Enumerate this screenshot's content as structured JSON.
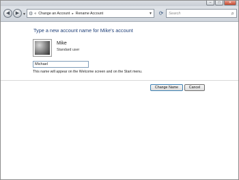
{
  "window_controls": {
    "minimize": "–",
    "maximize": "□",
    "close": "✕"
  },
  "nav": {
    "back_glyph": "◀",
    "forward_glyph": "▶",
    "breadcrumbs": [
      "Change an Account",
      "Rename Account"
    ],
    "breadcrumb_separator": "▸",
    "overflow_marker": "«",
    "search_placeholder": "Search"
  },
  "main": {
    "heading": "Type a new account name for Mike's account",
    "user": {
      "name": "Mike",
      "type": "Standard user"
    },
    "new_name_value": "Michael",
    "hint": "This name will appear on the Welcome screen and on the Start menu.",
    "buttons": {
      "change": "Change Name",
      "cancel": "Cancel"
    }
  },
  "colors": {
    "heading": "#1f3f77",
    "accent_button_border": "#3c7fb1"
  }
}
